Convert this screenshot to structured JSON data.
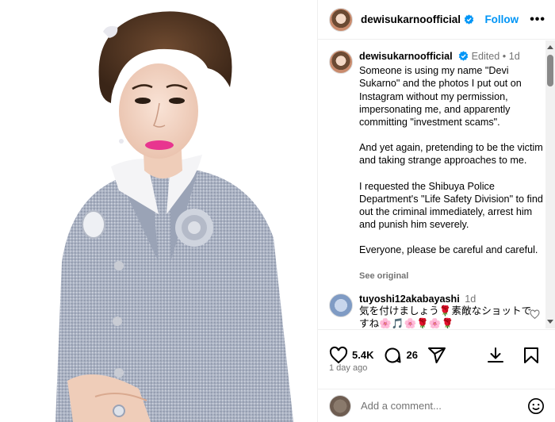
{
  "post": {
    "username": "dewisukarnoofficial",
    "follow_label": "Follow",
    "more_label": "•••",
    "verified_icon": "verified-badge-icon",
    "accent_color": "#0095f6"
  },
  "caption": {
    "username": "dewisukarnoofficial",
    "edited": "Edited",
    "separator": "•",
    "time": "1d",
    "paragraphs": [
      "Someone is using my name \"Devi Sukarno\" and the photos I put out on Instagram without my permission, impersonating me, and apparently committing \"investment scams\".",
      "And yet again, pretending to be the victim and taking strange approaches to me.",
      "I requested the Shibuya Police Department's \"Life Safety Division\" to find out the criminal immediately, arrest him and punish him severely.",
      "Everyone, please be careful and careful."
    ],
    "see_original": "See original"
  },
  "comment": {
    "username": "tuyoshi12akabayashi",
    "time": "1d",
    "text": "気を付けましょう🌹素敵なショットですね🌸🎵🌸🌹🌸🌹"
  },
  "actions": {
    "likes": "5.4K",
    "comments": "26",
    "time_ago": "1 day ago",
    "icons": [
      "heart-icon",
      "comment-icon",
      "share-icon",
      "download-icon",
      "bookmark-icon"
    ]
  },
  "add_comment": {
    "placeholder": "Add a comment..."
  }
}
